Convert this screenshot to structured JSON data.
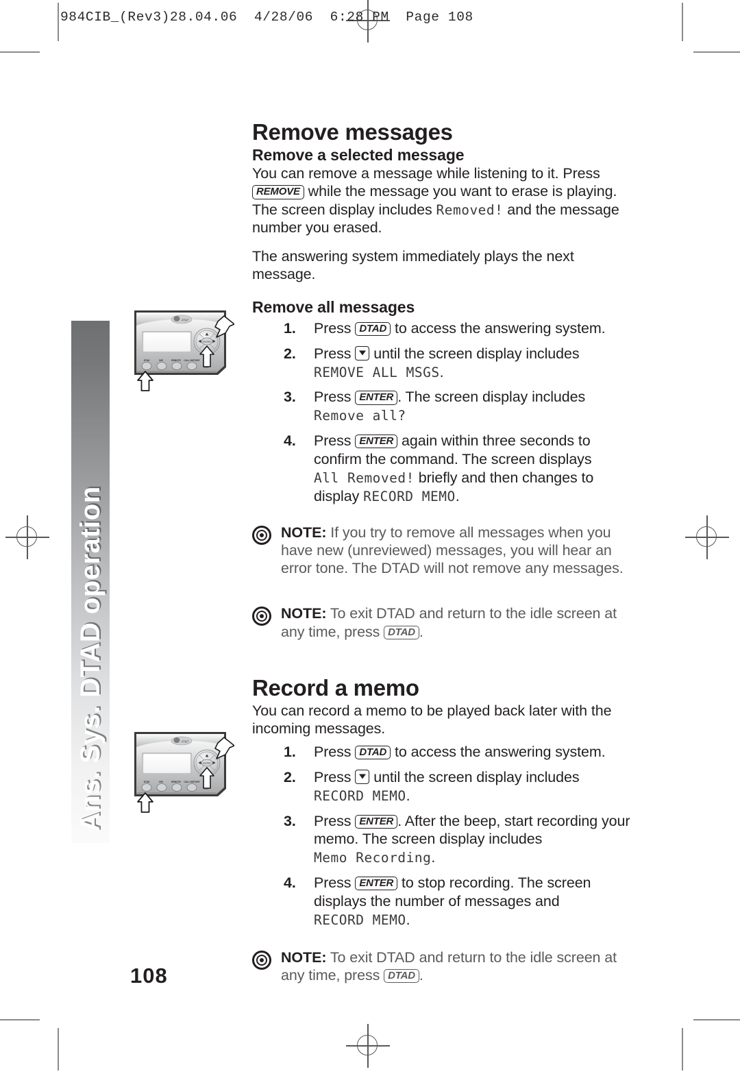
{
  "print_slug": "984CIB_(Rev3)28.04.06  4/28/06  6:28 PM  Page 108",
  "side_tab": {
    "label": "Ans. Sys. DTAD operation"
  },
  "page_number": "108",
  "sections": [
    {
      "id": "remove-messages",
      "title": "Remove messages",
      "subsections": [
        {
          "id": "remove-a-selected-message",
          "subtitle": "Remove a selected message",
          "paragraphs": [
            {
              "p1a": "You can remove a message while listening to it.  Press ",
              "key1": "REMOVE",
              "p1b": " while the message you want to erase is playing. The screen display includes ",
              "lcd1": "Removed!",
              "p1c": " and the message number you erased."
            },
            {
              "p2": "The answering system immediately plays the next message."
            }
          ]
        },
        {
          "id": "remove-all-messages",
          "subtitle": "Remove all messages",
          "steps": [
            {
              "num": "1.",
              "text_a": "Press ",
              "key": "DTAD",
              "text_b": " to access the answering system."
            },
            {
              "num": "2.",
              "text_a": "Press ",
              "key": "down-arrow",
              "text_b": " until the screen display includes ",
              "lcd": "REMOVE ALL MSGS",
              "text_c": "."
            },
            {
              "num": "3.",
              "text_a": "Press ",
              "key": "ENTER",
              "text_b": ". The screen display includes ",
              "lcd": "Remove all?"
            },
            {
              "num": "4.",
              "text_a": "Press ",
              "key": "ENTER",
              "text_b": " again within three seconds to confirm the command. The screen displays ",
              "lcd": "All Removed!",
              "text_c": " briefly and then changes to display ",
              "lcd2": "RECORD MEMO",
              "text_d": "."
            }
          ]
        }
      ],
      "notes": [
        {
          "label": "NOTE:",
          "text": " If you try to remove all messages when you have new (unreviewed) messages, you will hear an error tone.  The DTAD will not remove any messages."
        },
        {
          "label": "NOTE:",
          "text_a": " To exit DTAD and return to the idle screen at any time, press ",
          "key": "DTAD",
          "text_b": "."
        }
      ]
    },
    {
      "id": "record-a-memo",
      "title": "Record a memo",
      "intro": "You can record a memo to be played back later with the incoming messages.",
      "steps": [
        {
          "num": "1.",
          "text_a": "Press ",
          "key": "DTAD",
          "text_b": " to access the answering system."
        },
        {
          "num": "2.",
          "text_a": "Press ",
          "key": "down-arrow",
          "text_b": " until the screen display includes ",
          "lcd": "RECORD MEMO",
          "text_c": "."
        },
        {
          "num": "3.",
          "text_a": "Press ",
          "key": "ENTER",
          "text_b": ". After the beep, start recording your memo. The screen display includes ",
          "lcd": "Memo Recording",
          "text_c": "."
        },
        {
          "num": "4.",
          "text_a": "Press ",
          "key": "ENTER",
          "text_b": " to stop recording. The screen displays the number of messages and ",
          "lcd": "RECORD MEMO",
          "text_c": "."
        }
      ],
      "notes": [
        {
          "label": "NOTE:",
          "text_a": " To exit DTAD and return to the idle screen at any time, press ",
          "key": "DTAD",
          "text_b": "."
        }
      ]
    }
  ],
  "illustrations": [
    {
      "id": "phone-base-remove-all",
      "caption": "answering system base unit with navigation pad and button row, arrows indicating DTAD button and ENTER key"
    },
    {
      "id": "phone-base-record-memo",
      "caption": "answering system base unit with navigation pad and button row, arrows indicating DTAD button and ENTER key"
    }
  ],
  "colors": {
    "text": "#231f20",
    "note_text": "#5a5a5c",
    "tab_gradient_top": "#6e6f71",
    "tab_gradient_bottom": "#fbfbfb",
    "mark": "#58585a"
  }
}
